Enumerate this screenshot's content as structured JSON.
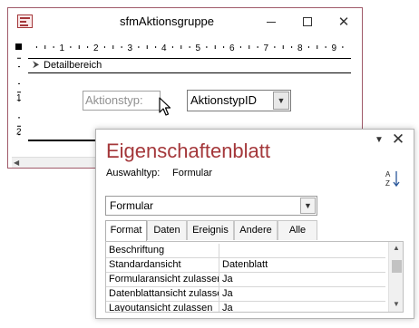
{
  "form_window": {
    "title": "sfmAktionsgruppe",
    "ruler_numbers": [
      "1",
      "2",
      "3",
      "4",
      "5",
      "6",
      "7",
      "8",
      "9"
    ],
    "vruler_numbers": [
      "1",
      "2"
    ],
    "section_label": "Detailbereich",
    "label_text": "Aktionstyp:",
    "combo_text": "AktionstypID"
  },
  "property_sheet": {
    "title": "Eigenschaftenblatt",
    "selection_type_label": "Auswahltyp:",
    "selection_type_value": "Formular",
    "object_select": "Formular",
    "tabs": [
      {
        "label": "Format",
        "active": true
      },
      {
        "label": "Daten",
        "active": false
      },
      {
        "label": "Ereignis",
        "active": false
      },
      {
        "label": "Andere",
        "active": false
      },
      {
        "label": "Alle",
        "active": false
      }
    ],
    "rows": [
      {
        "name": "Beschriftung",
        "value": ""
      },
      {
        "name": "Standardansicht",
        "value": "Datenblatt"
      },
      {
        "name": "Formularansicht zulassen",
        "value": "Ja"
      },
      {
        "name": "Datenblattansicht zulassen",
        "value": "Ja"
      },
      {
        "name": "Layoutansicht zulassen",
        "value": "Ja"
      }
    ]
  },
  "colors": {
    "accent": "#a4373a"
  }
}
